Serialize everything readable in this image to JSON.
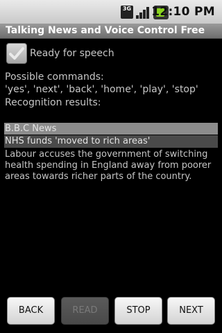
{
  "status_bar": {
    "network": "3G",
    "time": "12:10 PM"
  },
  "app": {
    "title": "Talking News and Voice Control Free"
  },
  "checkbox": {
    "label": "Ready for speech",
    "checked": true
  },
  "commands": {
    "label": "Possible commands:",
    "list": "'yes', 'next', 'back', 'home', 'play', 'stop'"
  },
  "recognition": {
    "label": "Recognition results:"
  },
  "news": {
    "source": "B.B.C News",
    "headline": "NHS funds 'moved to rich areas'",
    "body": "Labour accuses the government of switching health spending in England away from poorer areas towards richer parts of the country."
  },
  "buttons": {
    "back": "BACK",
    "read": "READ",
    "stop": "STOP",
    "next": "NEXT"
  },
  "colors": {
    "battery": "#8bd51f",
    "source_bg": "#8c8c8c",
    "headline_bg": "#4a4a4a"
  }
}
